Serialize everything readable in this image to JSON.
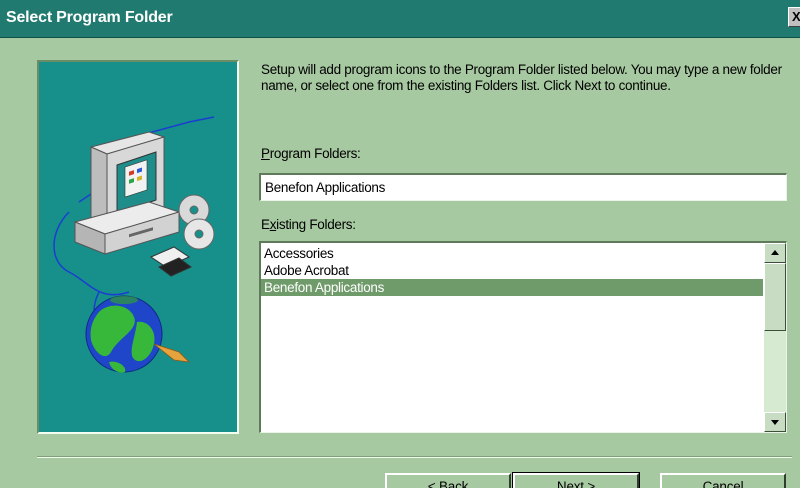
{
  "window": {
    "title": "Select Program Folder",
    "close_glyph": "X"
  },
  "intro_text": "Setup will add program icons to the Program Folder listed below.  You may type a new folder name, or select one from the existing Folders list.  Click Next to continue.",
  "program_folders": {
    "label_mnemonic": "P",
    "label_rest": "rogram Folders:",
    "value": "Benefon Applications"
  },
  "existing_folders": {
    "label_first": "E",
    "label_mnemonic": "x",
    "label_rest": "isting Folders:",
    "items": [
      "Accessories",
      "Adobe Acrobat",
      "Benefon Applications"
    ],
    "selected": "Benefon Applications"
  },
  "buttons": {
    "back": "< Back",
    "next": "Next >",
    "cancel": "Cancel"
  },
  "colors": {
    "background": "#a7c9a1",
    "titlebar": "#217a70",
    "art_panel": "#178f8a",
    "selection": "#6f9a69"
  }
}
